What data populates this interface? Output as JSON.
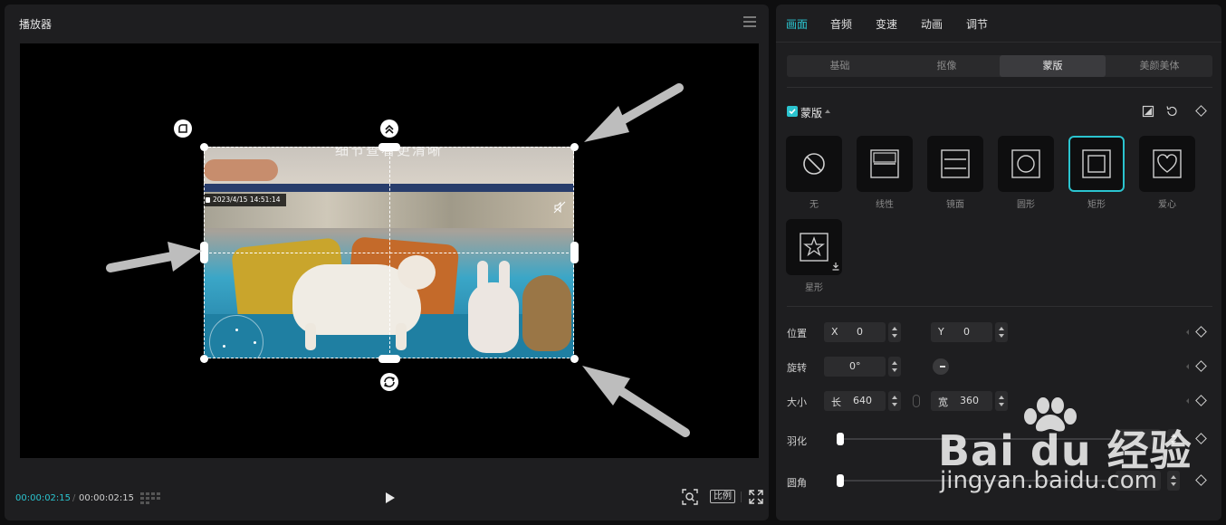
{
  "player": {
    "title": "播放器",
    "current_time": "00:00:02:15",
    "time_separator": "/",
    "total_time": "00:00:02:15",
    "ratio_label": "比例"
  },
  "video": {
    "caption": "细节查看更清晰",
    "timestamp": "2023/4/15 14:51:14"
  },
  "panel": {
    "tabs": [
      "画面",
      "音频",
      "变速",
      "动画",
      "调节"
    ],
    "active_tab": "画面",
    "subtabs": [
      "基础",
      "抠像",
      "蒙版",
      "美颜美体"
    ],
    "active_subtab": "蒙版",
    "mask_section_title": "蒙版",
    "mask_types": [
      {
        "label": "无",
        "icon": "none-icon"
      },
      {
        "label": "线性",
        "icon": "linear-mask-icon"
      },
      {
        "label": "镜面",
        "icon": "mirror-mask-icon"
      },
      {
        "label": "圆形",
        "icon": "circle-mask-icon"
      },
      {
        "label": "矩形",
        "icon": "rectangle-mask-icon"
      },
      {
        "label": "爱心",
        "icon": "heart-mask-icon"
      },
      {
        "label": "星形",
        "icon": "star-mask-icon"
      }
    ],
    "selected_mask": "矩形",
    "position": {
      "label": "位置",
      "x_prefix": "X",
      "x": "0",
      "y_prefix": "Y",
      "y": "0"
    },
    "rotation": {
      "label": "旋转",
      "value": "0°"
    },
    "size": {
      "label": "大小",
      "w_prefix": "长",
      "w": "640",
      "h_prefix": "宽",
      "h": "360"
    },
    "feather": {
      "label": "羽化",
      "value": 0
    },
    "corner": {
      "label": "圆角",
      "value": 0
    }
  },
  "watermark": {
    "brand": "Bai du 经验",
    "url": "jingyan.baidu.com"
  },
  "colors": {
    "accent": "#2bc4cf",
    "panel_bg": "#1e1e20",
    "app_bg": "#0e0e0f"
  }
}
